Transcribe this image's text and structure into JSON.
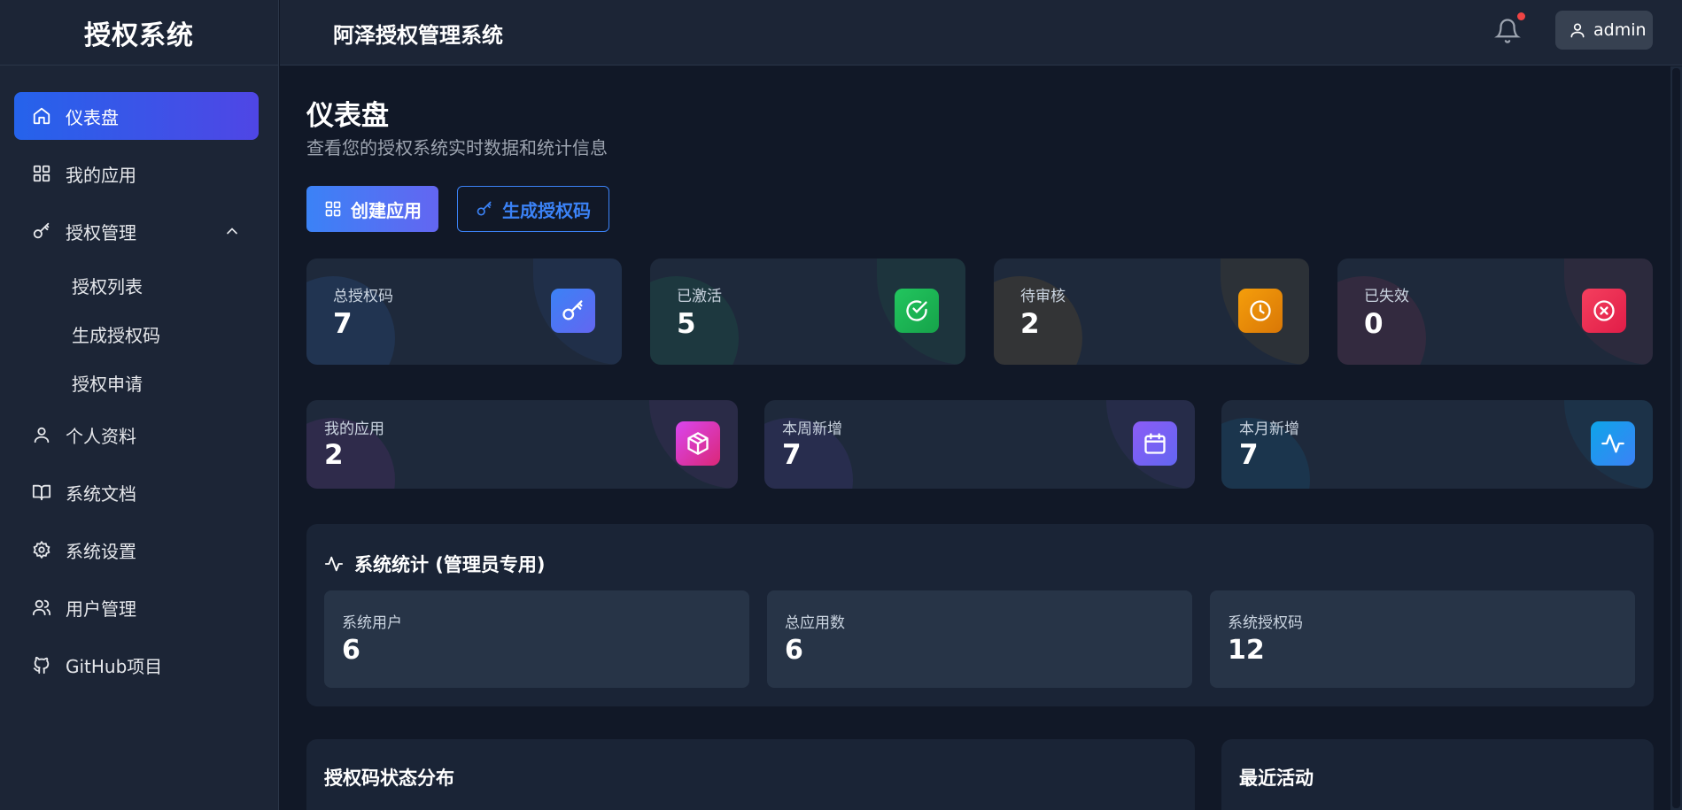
{
  "sidebar": {
    "brand": "授权系统",
    "items": [
      {
        "label": "仪表盘"
      },
      {
        "label": "我的应用"
      },
      {
        "label": "授权管理"
      },
      {
        "label": "个人资料"
      },
      {
        "label": "系统文档"
      },
      {
        "label": "系统设置"
      },
      {
        "label": "用户管理"
      },
      {
        "label": "GitHub项目"
      }
    ],
    "sub_items": [
      {
        "label": "授权列表"
      },
      {
        "label": "生成授权码"
      },
      {
        "label": "授权申请"
      }
    ]
  },
  "header": {
    "title": "阿泽授权管理系统",
    "user": "admin"
  },
  "main": {
    "title": "仪表盘",
    "subtitle": "查看您的授权系统实时数据和统计信息",
    "create_app_label": "创建应用",
    "generate_code_label": "生成授权码",
    "stats": [
      {
        "label": "总授权码",
        "value": "7"
      },
      {
        "label": "已激活",
        "value": "5"
      },
      {
        "label": "待审核",
        "value": "2"
      },
      {
        "label": "已失效",
        "value": "0"
      }
    ],
    "stats2": [
      {
        "label": "我的应用",
        "value": "2"
      },
      {
        "label": "本周新增",
        "value": "7"
      },
      {
        "label": "本月新增",
        "value": "7"
      }
    ],
    "system_panel": {
      "title": "系统统计 (管理员专用)",
      "items": [
        {
          "label": "系统用户",
          "value": "6"
        },
        {
          "label": "总应用数",
          "value": "6"
        },
        {
          "label": "系统授权码",
          "value": "12"
        }
      ]
    },
    "distribution_title": "授权码状态分布",
    "recent_title": "最近活动"
  },
  "colors": {
    "accent_blue": "#3b82f6",
    "indigo": "#6366f1",
    "green": "#22c55e",
    "amber": "#f59e0b",
    "red": "#f43f5e",
    "fuchsia": "#d946ef",
    "violet": "#8b5cf6",
    "sky": "#0ea5e9",
    "notification_dot": "#ef4444"
  }
}
